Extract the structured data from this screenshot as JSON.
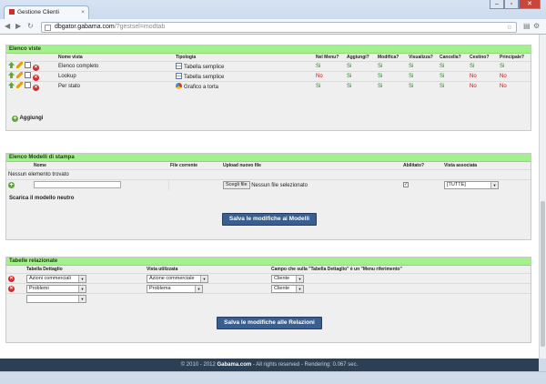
{
  "browser": {
    "tab_title": "Gestione Clienti",
    "tab_close": "×",
    "url_host": "dbgator.gabama.com",
    "url_path": "/?gestsel=modtab"
  },
  "viste": {
    "title": "Elenco viste",
    "headers": [
      "Nome vista",
      "Tipologia",
      "Nel Menu?",
      "Aggiungi?",
      "Modifica?",
      "Visualizza?",
      "Cancella?",
      "Cestino?",
      "Principale?"
    ],
    "rows": [
      {
        "name": "Elenco completo",
        "type": "Tabella semplice",
        "type_icon": "table-icon",
        "flags": [
          "Si",
          "Si",
          "Si",
          "Si",
          "Si",
          "Si",
          "Si"
        ]
      },
      {
        "name": "Lookup",
        "type": "Tabella semplice",
        "type_icon": "table-icon",
        "flags": [
          "No",
          "Si",
          "Si",
          "Si",
          "Si",
          "No",
          "No"
        ]
      },
      {
        "name": "Per stato",
        "type": "Grafico a torta",
        "type_icon": "pie-chart-icon",
        "flags": [
          "Si",
          "Si",
          "Si",
          "Si",
          "Si",
          "No",
          "No"
        ]
      }
    ],
    "add_label": "Aggiungi"
  },
  "modelli": {
    "title": "Elenco Modelli di stampa",
    "headers": [
      "Nome",
      "File corrente",
      "Upload nuovo file",
      "Abilitato?",
      "Vista associata"
    ],
    "empty_text": "Nessun elemento trovato",
    "file_button": "Scegli file",
    "file_status": "Nessun file selezionato",
    "vista_value": "[TUTTE]",
    "download_link": "Scarica il modello neutro",
    "save_button": "Salva le modifiche ai Modelli"
  },
  "relazioni": {
    "title": "Tabelle relazionate",
    "headers": [
      "Tabella Dettaglio",
      "Vista utilizzata",
      "Campo che sulla \"Tabella Dettaglio\" è un \"Menu riferimento\""
    ],
    "rows": [
      {
        "tabella": "Azioni commerciali",
        "vista": "Azione commerciale",
        "campo": "Cliente"
      },
      {
        "tabella": "Problemi",
        "vista": "Problema",
        "campo": "Cliente"
      }
    ],
    "save_button": "Salva le modifiche alle Relazioni"
  },
  "footer": {
    "prefix": "© 2010 - 2012 ",
    "brand": "Gabama.com",
    "suffix": " - All rights reserved - Rendering: 0.067 sec."
  },
  "colors": {
    "panel_header": "#a4f08c",
    "button": "#3a5f8e",
    "footer": "#2d3f52",
    "yes": "#1a8a1a",
    "no": "#cc1111"
  }
}
